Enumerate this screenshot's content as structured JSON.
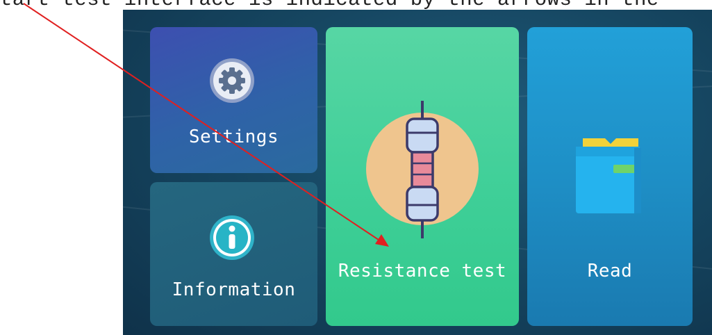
{
  "caption": {
    "text": "Start test interface is indicated by the arrows in the"
  },
  "menu": {
    "settings": {
      "label": "Settings",
      "icon": "gear-icon"
    },
    "information": {
      "label": "Information",
      "icon": "info-icon"
    },
    "resistance_test": {
      "label": "Resistance test",
      "icon": "resistor-icon"
    },
    "read": {
      "label": "Read",
      "icon": "book-icon"
    }
  },
  "annotation": {
    "arrow_color": "#e02020",
    "points_to": "resistance-test-tile"
  },
  "colors": {
    "screen_bg": "#164762",
    "settings_tile": "#3d4fb0",
    "information_tile": "#1f5c78",
    "resistance_tile": "#3fcf98",
    "read_tile": "#1e8fc6"
  }
}
